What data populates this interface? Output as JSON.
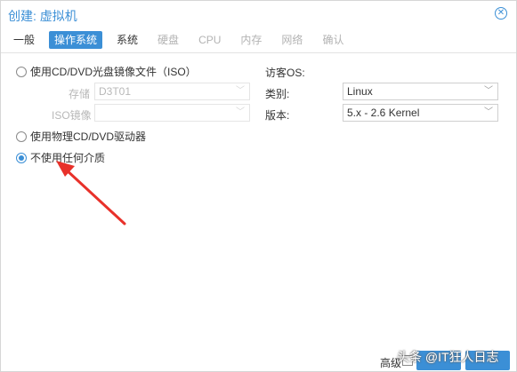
{
  "dialog": {
    "title": "创建: 虚拟机",
    "close_icon": "close-circle-icon"
  },
  "tabs": [
    {
      "label": "一般",
      "state": "normal"
    },
    {
      "label": "操作系统",
      "state": "active"
    },
    {
      "label": "系统",
      "state": "normal"
    },
    {
      "label": "硬盘",
      "state": "disabled"
    },
    {
      "label": "CPU",
      "state": "disabled"
    },
    {
      "label": "内存",
      "state": "disabled"
    },
    {
      "label": "网络",
      "state": "disabled"
    },
    {
      "label": "确认",
      "state": "disabled"
    }
  ],
  "media": {
    "option_iso": "使用CD/DVD光盘镜像文件（ISO）",
    "storage_label": "存储",
    "storage_value": "D3T01",
    "iso_label": "ISO镜像",
    "iso_value": "",
    "option_physical": "使用物理CD/DVD驱动器",
    "option_none": "不使用任何介质",
    "selected": "option_none"
  },
  "guest_os": {
    "heading": "访客OS:",
    "type_label": "类别:",
    "type_value": "Linux",
    "version_label": "版本:",
    "version_value": "5.x - 2.6 Kernel"
  },
  "footer": {
    "advanced_label": "高级"
  },
  "watermark": "头条 @IT狂人日志",
  "colors": {
    "accent": "#3b8fd6",
    "arrow": "#e8312a"
  }
}
